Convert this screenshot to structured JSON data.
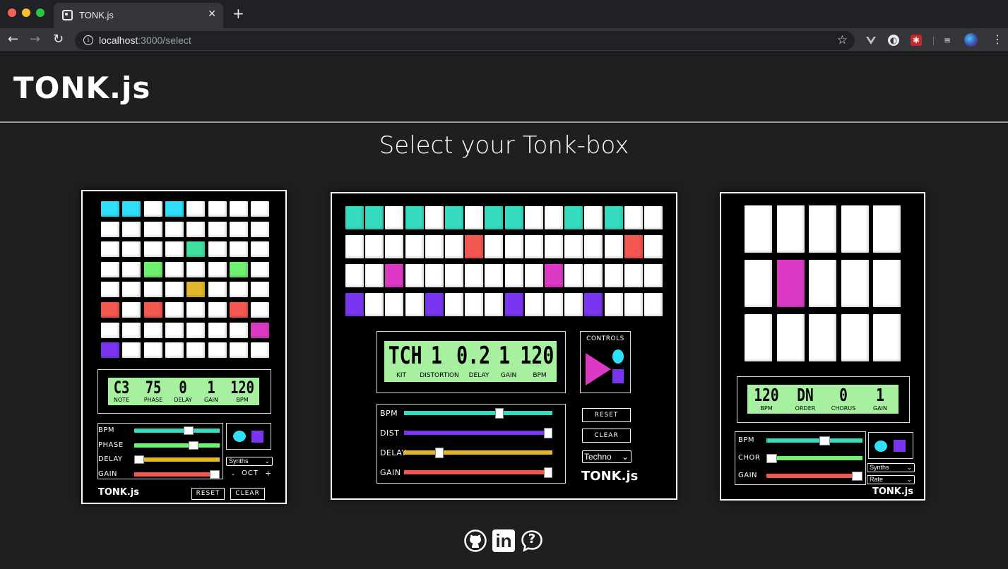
{
  "browser": {
    "tab_title": "TONK.js",
    "tab_close": "✕",
    "new_tab": "+",
    "url_host": "localhost",
    "url_path": ":3000/select",
    "back": "←",
    "forward": "→",
    "reload": "↻",
    "info": "i",
    "star": "☆",
    "ext_icons": [
      "vue-devtools-icon",
      "privacy-icon",
      "extension-icon",
      "playlist-icon",
      "profile-avatar-icon"
    ],
    "kebab": "⋮"
  },
  "site": {
    "title": "TONK.js",
    "heading": "Select your Tonk-box"
  },
  "colors": {
    "cyan": "#2ee0fa",
    "teal": "#36dcbf",
    "mint": "#3fe0a0",
    "green": "#6ff06f",
    "yellow": "#e2b82a",
    "red": "#f4574f",
    "magenta": "#dc3ac4",
    "purple": "#7b34f0",
    "lcd": "#a6f0a0"
  },
  "box1": {
    "pads": [
      [
        "cyan",
        "cyan",
        "white",
        "cyan",
        "white",
        "white",
        "white",
        "white"
      ],
      [
        "white",
        "white",
        "white",
        "white",
        "white",
        "white",
        "white",
        "white"
      ],
      [
        "white",
        "white",
        "white",
        "white",
        "mint",
        "white",
        "white",
        "white"
      ],
      [
        "white",
        "white",
        "green",
        "white",
        "white",
        "white",
        "green",
        "white"
      ],
      [
        "white",
        "white",
        "white",
        "white",
        "yellow",
        "white",
        "white",
        "white"
      ],
      [
        "red",
        "white",
        "red",
        "white",
        "white",
        "white",
        "red",
        "white"
      ],
      [
        "white",
        "white",
        "white",
        "white",
        "white",
        "white",
        "white",
        "magenta"
      ],
      [
        "purple",
        "white",
        "white",
        "white",
        "white",
        "white",
        "white",
        "white"
      ]
    ],
    "lcd_values": [
      "C3",
      "75",
      "0",
      "1",
      "120"
    ],
    "lcd_labels": [
      "NOTE",
      "PHASE",
      "DELAY",
      "GAIN",
      "BPM"
    ],
    "sliders": [
      {
        "label": "BPM",
        "color": "#36dcbf",
        "value": 0.65
      },
      {
        "label": "PHASE",
        "color": "#6ff06f",
        "value": 0.72
      },
      {
        "label": "DELAY",
        "color": "#e2b82a",
        "value": 0.0
      },
      {
        "label": "GAIN",
        "color": "#f4574f",
        "value": 1.0
      }
    ],
    "select": "Synths",
    "octave_minus": "-",
    "octave_label": "OCT",
    "octave_plus": "+",
    "logo": "TONK.js",
    "reset": "RESET",
    "clear": "CLEAR"
  },
  "box2": {
    "pads": [
      [
        "teal",
        "teal",
        "white",
        "teal",
        "white",
        "teal",
        "white",
        "teal",
        "teal",
        "white",
        "white",
        "teal",
        "white",
        "teal",
        "white",
        "white"
      ],
      [
        "white",
        "white",
        "white",
        "white",
        "white",
        "white",
        "red",
        "white",
        "white",
        "white",
        "white",
        "white",
        "white",
        "white",
        "red",
        "white"
      ],
      [
        "white",
        "white",
        "magenta",
        "white",
        "white",
        "white",
        "white",
        "white",
        "white",
        "white",
        "magenta",
        "white",
        "white",
        "white",
        "white",
        "white"
      ],
      [
        "purple",
        "white",
        "white",
        "white",
        "purple",
        "white",
        "white",
        "white",
        "purple",
        "white",
        "white",
        "white",
        "purple",
        "white",
        "white",
        "white"
      ]
    ],
    "lcd_values": [
      "TCH",
      "1",
      "0.2",
      "1",
      "120"
    ],
    "lcd_labels": [
      "KIT",
      "DISTORTION",
      "DELAY",
      "GAIN",
      "BPM"
    ],
    "controls_label": "CONTROLS",
    "sliders": [
      {
        "label": "BPM",
        "color": "#36dcbf",
        "value": 0.65
      },
      {
        "label": "DIST",
        "color": "#7b34f0",
        "value": 1.0
      },
      {
        "label": "DELAY",
        "color": "#e2b82a",
        "value": 0.22
      },
      {
        "label": "GAIN",
        "color": "#f4574f",
        "value": 1.0
      }
    ],
    "reset": "RESET",
    "clear": "CLEAR",
    "select": "Techno",
    "logo": "TONK.js"
  },
  "box3": {
    "pads": [
      [
        "white",
        "white",
        "white",
        "white",
        "white"
      ],
      [
        "white",
        "magenta",
        "white",
        "white",
        "white"
      ],
      [
        "white",
        "white",
        "white",
        "white",
        "white"
      ]
    ],
    "lcd_values": [
      "120",
      "DN",
      "0",
      "1"
    ],
    "lcd_labels": [
      "BPM",
      "ORDER",
      "CHORUS",
      "GAIN"
    ],
    "sliders": [
      {
        "label": "BPM",
        "color": "#36dcbf",
        "value": 0.62
      },
      {
        "label": "CHOR",
        "color": "#6ff06f",
        "value": 0.0
      },
      {
        "label": "GAIN",
        "color": "#f4574f",
        "value": 1.0
      }
    ],
    "select1": "Synths",
    "select2": "Rate",
    "logo": "TONK.js"
  },
  "footer": {
    "icons": [
      "github-icon",
      "linkedin-icon",
      "help-icon"
    ],
    "linkedin_text": "in",
    "help_text": "?"
  }
}
